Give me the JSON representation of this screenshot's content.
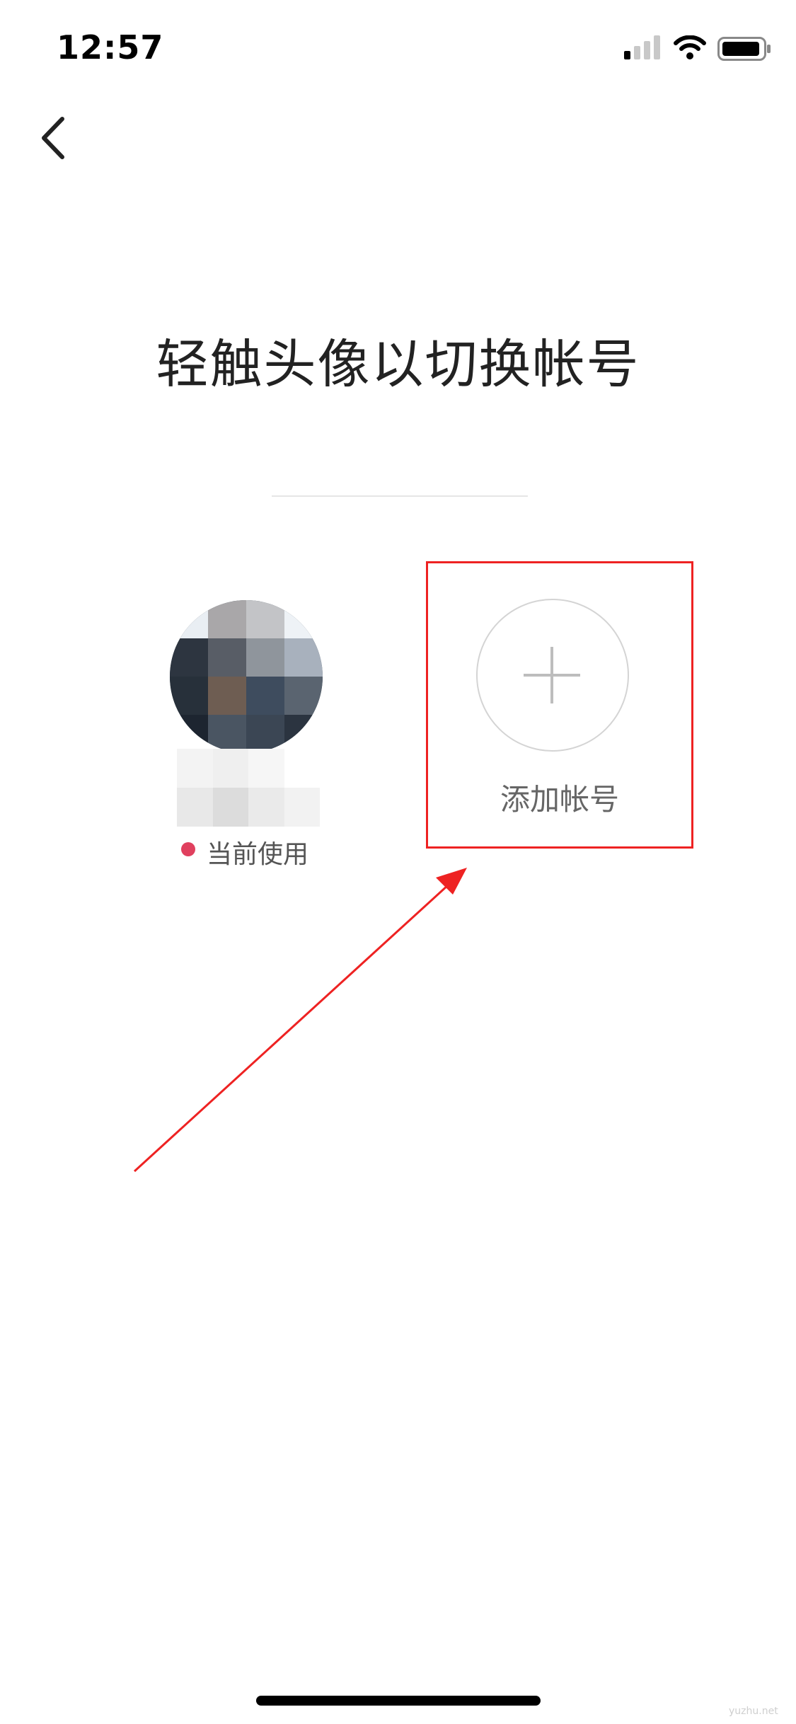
{
  "status_bar": {
    "time": "12:57",
    "icons": [
      "cellular-signal-icon",
      "wifi-icon",
      "battery-icon"
    ]
  },
  "nav": {
    "back_icon": "chevron-left-icon"
  },
  "page": {
    "title": "轻触头像以切换帐号"
  },
  "accounts": {
    "current": {
      "status_label": "当前使用",
      "status_color": "#e0405e"
    },
    "add": {
      "label": "添加帐号",
      "icon": "plus-icon"
    }
  },
  "annotation": {
    "box_color": "#ee2222",
    "arrow_color": "#ee2222"
  },
  "watermark": "yuzhu.net"
}
